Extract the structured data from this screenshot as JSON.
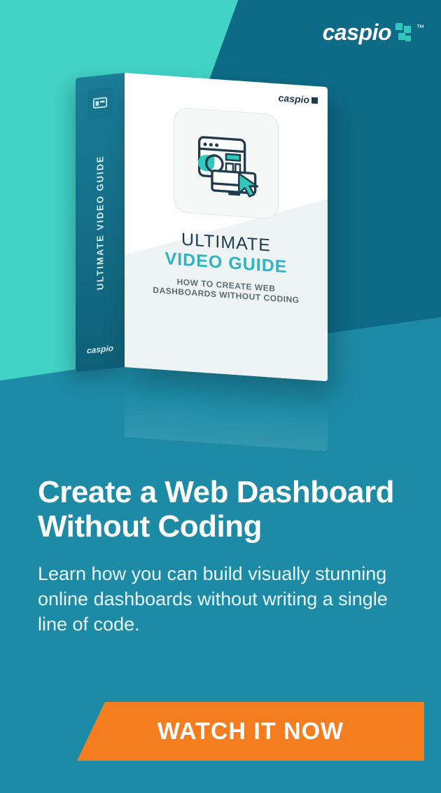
{
  "brand": {
    "name": "caspio",
    "tm": "™"
  },
  "box": {
    "spine_label": "ULTIMATE VIDEO GUIDE",
    "spine_logo": "caspio",
    "front_logo": "caspio",
    "title_line1": "ULTIMATE",
    "title_line2": "VIDEO GUIDE",
    "subtitle_line1": "HOW TO CREATE WEB",
    "subtitle_line2": "DASHBOARDS WITHOUT CODING"
  },
  "headline": "Create a Web Dashboard Without Coding",
  "body": "Learn how you can build visually stunning online dashboards without writing a single line of code.",
  "cta_label": "WATCH IT NOW"
}
